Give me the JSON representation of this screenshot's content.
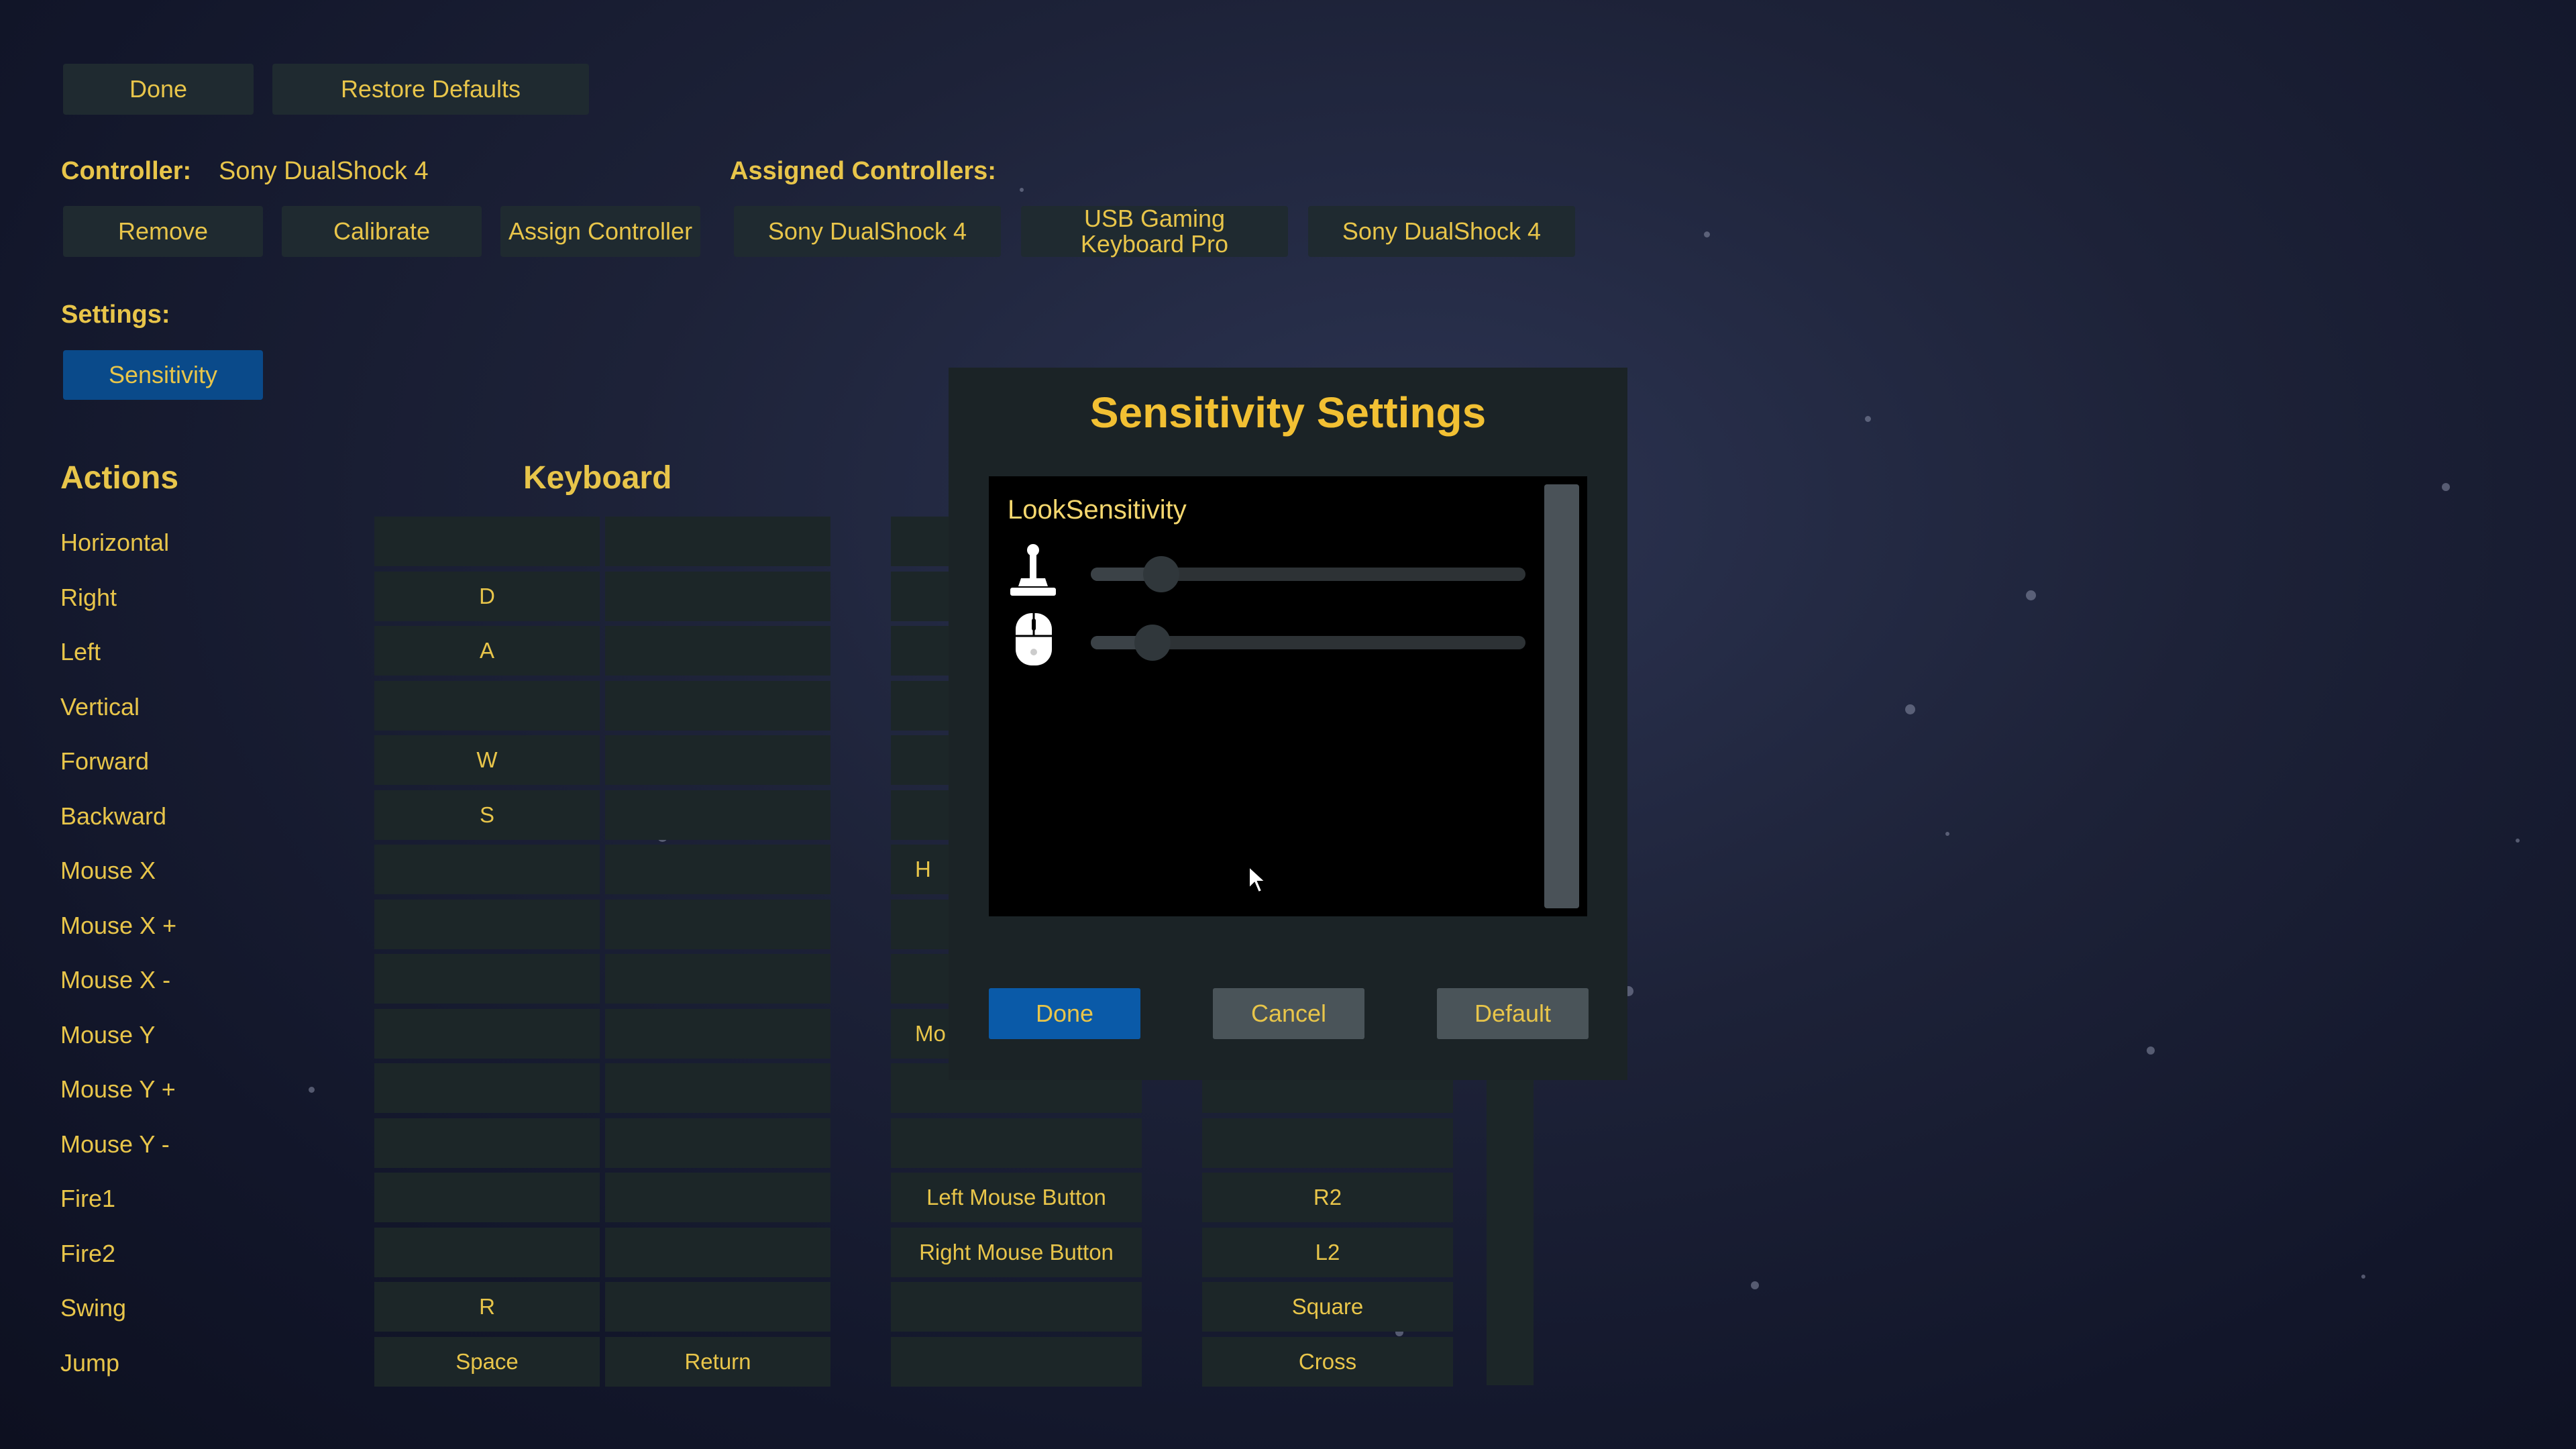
{
  "top_bar": {
    "done_label": "Done",
    "restore_label": "Restore Defaults"
  },
  "controller": {
    "label": "Controller:",
    "name": "Sony DualShock 4",
    "remove_label": "Remove",
    "calibrate_label": "Calibrate",
    "assign_label": "Assign Controller"
  },
  "assigned": {
    "label": "Assigned Controllers:",
    "items": [
      "Sony DualShock 4",
      "USB Gaming Keyboard Pro",
      "Sony DualShock 4"
    ]
  },
  "settings": {
    "label": "Settings:",
    "sensitivity_label": "Sensitivity"
  },
  "table": {
    "actions_header": "Actions",
    "keyboard_header": "Keyboard",
    "rows": [
      {
        "action": "Horizontal",
        "kb1": "",
        "kb2": "",
        "c3": "",
        "c4": ""
      },
      {
        "action": "Right",
        "kb1": "D",
        "kb2": "",
        "c3": "",
        "c4": ""
      },
      {
        "action": "Left",
        "kb1": "A",
        "kb2": "",
        "c3": "",
        "c4": ""
      },
      {
        "action": "Vertical",
        "kb1": "",
        "kb2": "",
        "c3": "",
        "c4": ""
      },
      {
        "action": "Forward",
        "kb1": "W",
        "kb2": "",
        "c3": "",
        "c4": ""
      },
      {
        "action": "Backward",
        "kb1": "S",
        "kb2": "",
        "c3": "",
        "c4": ""
      },
      {
        "action": "Mouse X",
        "kb1": "",
        "kb2": "",
        "c3": "H",
        "c4": ""
      },
      {
        "action": "Mouse X +",
        "kb1": "",
        "kb2": "",
        "c3": "",
        "c4": ""
      },
      {
        "action": "Mouse X -",
        "kb1": "",
        "kb2": "",
        "c3": "",
        "c4": ""
      },
      {
        "action": "Mouse Y",
        "kb1": "",
        "kb2": "",
        "c3": "Mo",
        "c4": ""
      },
      {
        "action": "Mouse Y +",
        "kb1": "",
        "kb2": "",
        "c3": "",
        "c4": ""
      },
      {
        "action": "Mouse Y -",
        "kb1": "",
        "kb2": "",
        "c3": "",
        "c4": ""
      },
      {
        "action": "Fire1",
        "kb1": "",
        "kb2": "",
        "c3": "Left Mouse Button",
        "c4": "R2"
      },
      {
        "action": "Fire2",
        "kb1": "",
        "kb2": "",
        "c3": "Right Mouse Button",
        "c4": "L2"
      },
      {
        "action": "Swing",
        "kb1": "R",
        "kb2": "",
        "c3": "",
        "c4": "Square"
      },
      {
        "action": "Jump",
        "kb1": "Space",
        "kb2": "Return",
        "c3": "",
        "c4": "Cross"
      }
    ]
  },
  "modal": {
    "title": "Sensitivity Settings",
    "panel_label": "LookSensitivity",
    "sliders": [
      {
        "icon": "joystick-icon",
        "value": 0.12
      },
      {
        "icon": "mouse-icon",
        "value": 0.1
      }
    ],
    "done_label": "Done",
    "cancel_label": "Cancel",
    "default_label": "Default"
  },
  "colors": {
    "accent_text": "#e8c54a",
    "selected_button": "#0a4a8a",
    "title": "#f2c033"
  }
}
